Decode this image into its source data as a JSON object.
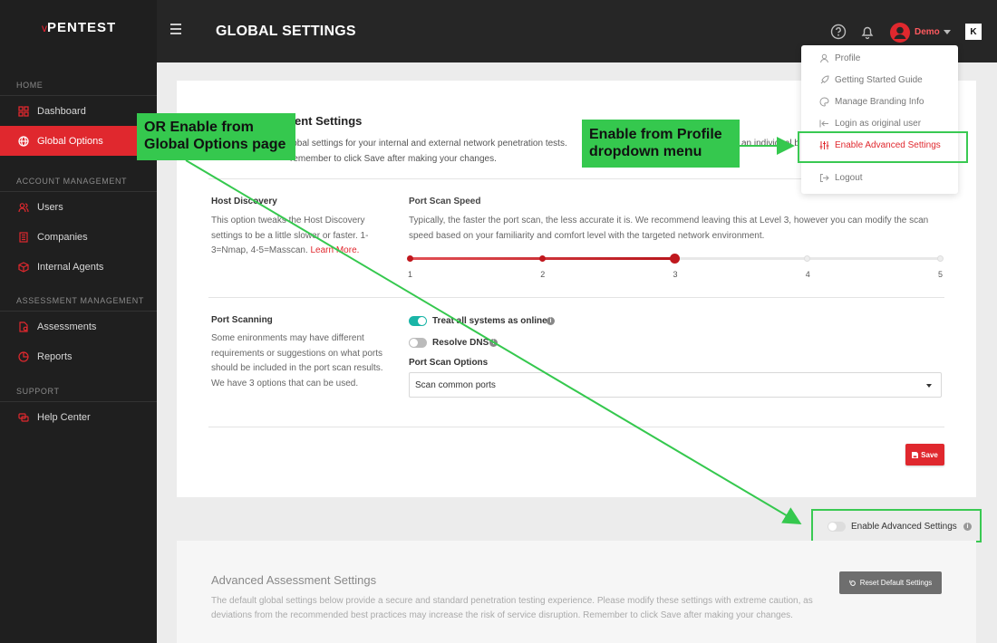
{
  "app": {
    "logo": "PENTEST",
    "logo_prefix": "v"
  },
  "header": {
    "title": "GLOBAL SETTINGS",
    "user_name": "Demo",
    "brand_badge": "K"
  },
  "sidebar": {
    "sections": [
      {
        "label": "HOME"
      },
      {
        "label": "ACCOUNT MANAGEMENT"
      },
      {
        "label": "ASSESSMENT MANAGEMENT"
      },
      {
        "label": "SUPPORT"
      }
    ],
    "items": [
      {
        "label": "Dashboard",
        "icon": "grid-icon"
      },
      {
        "label": "Global Options",
        "icon": "globe-icon",
        "active": true
      },
      {
        "label": "Users",
        "icon": "users-icon"
      },
      {
        "label": "Companies",
        "icon": "building-icon"
      },
      {
        "label": "Internal Agents",
        "icon": "cube-icon"
      },
      {
        "label": "Assessments",
        "icon": "document-icon"
      },
      {
        "label": "Reports",
        "icon": "chart-icon"
      },
      {
        "label": "Help Center",
        "icon": "help-icon"
      }
    ]
  },
  "profile_menu": {
    "items": [
      {
        "label": "Profile",
        "icon": "user-icon"
      },
      {
        "label": "Getting Started Guide",
        "icon": "rocket-icon"
      },
      {
        "label": "Manage Branding Info",
        "icon": "palette-icon"
      },
      {
        "label": "Login as original user",
        "icon": "login-icon"
      },
      {
        "label": "Enable Advanced Settings",
        "icon": "sliders-icon"
      },
      {
        "label": "Logout",
        "icon": "logout-icon"
      }
    ]
  },
  "settings": {
    "title": "ent Settings",
    "desc_line1": "lobal settings for your internal and external network penetration tests.",
    "desc_line1_tail": "an individual b",
    "desc_line2": "remember to click Save after making your changes.",
    "host_discovery": {
      "label": "Host Discovery",
      "text": "This option tweaks the Host Discovery settings to be a little slower or faster. 1-3=Nmap, 4-5=Masscan.",
      "link": "Learn More."
    },
    "port_scan_speed": {
      "label": "Port Scan Speed",
      "text": "Typically, the faster the port scan, the less accurate it is. We recommend leaving this at Level 3, however you can modify the scan speed based on your familiarity and comfort level with the targeted network environment.",
      "levels": [
        "1",
        "2",
        "3",
        "4",
        "5"
      ],
      "value": 3
    },
    "port_scanning": {
      "label": "Port Scanning",
      "text": "Some enironments may have different requirements or suggestions on what ports should be included in the port scan results. We have 3 options that can be used.",
      "treat_online_label": "Treat all systems as online",
      "treat_online": true,
      "resolve_dns_label": "Resolve DNS",
      "resolve_dns": false,
      "options_label": "Port Scan Options",
      "selected_option": "Scan common ports"
    },
    "save_label": "Save",
    "advanced_toggle_label": "Enable Advanced Settings",
    "advanced_toggle": false
  },
  "advanced": {
    "title": "Advanced Assessment Settings",
    "desc": "The default global settings below provide a secure and standard penetration testing experience. Please modify these settings with extreme caution, as deviations from the recommended best practices may increase the risk of service disruption. Remember to click Save after making your changes.",
    "reset_label": "Reset Default Settings"
  },
  "annotations": {
    "left_callout": [
      "OR Enable from",
      "Global Options page"
    ],
    "right_callout": [
      "Enable from Profile",
      "dropdown menu"
    ],
    "color": "#35c84e"
  },
  "colors": {
    "accent": "#e0282e",
    "toggle_on": "#1ab5a7",
    "sidebar": "#1f1f1f",
    "topbar": "#262626"
  }
}
